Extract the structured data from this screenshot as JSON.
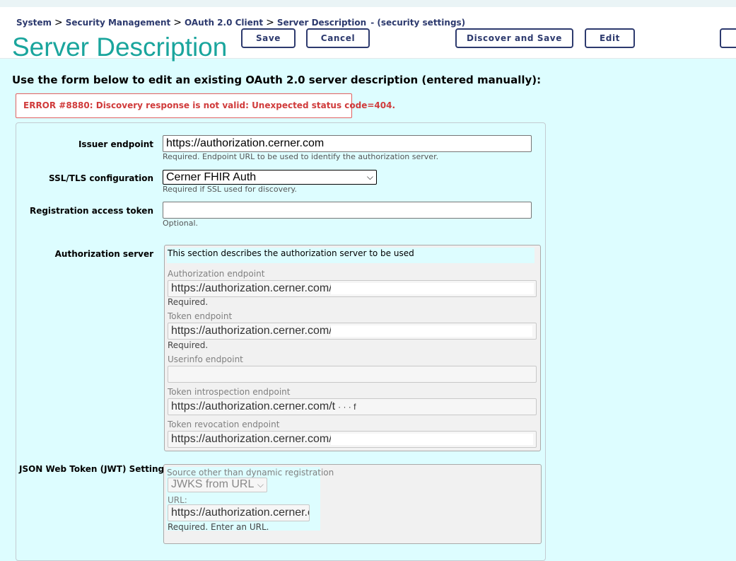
{
  "breadcrumb": {
    "items": [
      "System",
      "Security Management",
      "OAuth 2.0 Client",
      "Server Description"
    ],
    "separator": ">",
    "suffix": "- (security settings)"
  },
  "header": {
    "title": "Server Description",
    "buttons": {
      "save": "Save",
      "cancel": "Cancel",
      "discover_save": "Discover and Save",
      "edit": "Edit"
    }
  },
  "intro": "Use the form below to edit an existing OAuth 2.0 server description (entered manually):",
  "error": "ERROR #8880: Discovery response is not valid: Unexpected status code=404.",
  "form": {
    "issuer": {
      "label": "Issuer endpoint",
      "value": "https://authorization.cerner.com",
      "help": "Required. Endpoint URL to be used to identify the authorization server."
    },
    "ssl": {
      "label": "SSL/TLS configuration",
      "value": "Cerner FHIR Auth",
      "help": "Required if SSL used for discovery."
    },
    "reg_token": {
      "label": "Registration access token",
      "value": "",
      "help": "Optional."
    },
    "auth_server": {
      "label": "Authorization server",
      "description": "This section describes the authorization server to be used",
      "authorization_endpoint": {
        "label": "Authorization endpoint",
        "value": "https://authorization.cerner.com/",
        "help": "Required."
      },
      "token_endpoint": {
        "label": "Token endpoint",
        "value": "https://authorization.cerner.com/",
        "help": "Required."
      },
      "userinfo_endpoint": {
        "label": "Userinfo endpoint",
        "value": ""
      },
      "introspection_endpoint": {
        "label": "Token introspection endpoint",
        "value": "https://authorization.cerner.com/t",
        "trailing": "·  ·  ·   f"
      },
      "revocation_endpoint": {
        "label": "Token revocation endpoint",
        "value": "https://authorization.cerner.com/"
      }
    },
    "jwt": {
      "label": "JSON Web Token (JWT) Settings",
      "source_label": "Source other than dynamic registration",
      "source_value": "JWKS from URL",
      "url_label": "URL:",
      "url_value": "https://authorization.cerner.c",
      "url_help": "Required. Enter an URL."
    }
  }
}
